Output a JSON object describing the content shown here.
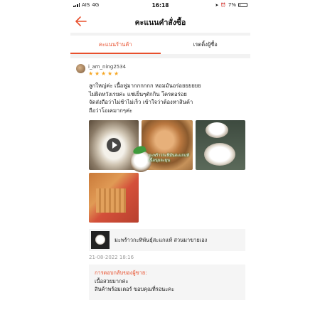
{
  "status_bar": {
    "carrier": "AIS",
    "network": "4G",
    "time": "16:18",
    "battery": "7%"
  },
  "header": {
    "title": "คะแนนคำสั่งซื้อ"
  },
  "tabs": [
    {
      "label": "คะแนนร้านค้า",
      "active": true
    },
    {
      "label": "เรตติ้งผู้ซื้อ",
      "active": false
    }
  ],
  "review": {
    "username": "i_am_ning2534",
    "rating": 5,
    "lines": [
      "ลูกใหญ่ค่ะ เนื้อฟูมากกกกกก หอมมันอร่อยยยยยย",
      "ไม่ผิดหวังเรยค่ะ แช่เย็นๆตักกิน โครตอร่อย",
      "จัดส่งถือว่าไม่ช้าไม่เร็ว เข้าใจว่าต้องหาสินค้า",
      "ถือว่าโอเคมากๆค่ะ"
    ],
    "promo_overlay": [
      "มะพร้าวกะทิมันสะแกแท้",
      "เนื้อนุ่มละมุน"
    ],
    "product_name": "มะพร้าวกะทิพันธุ์สะแกแท้ สวนมาขายเอง",
    "date": "21-08-2022 18:16"
  },
  "seller_reply": {
    "title": "การตอบกลับของผู้ขาย:",
    "lines": [
      "เนื้อสวยมากค่ะ",
      "สินค้าพร้อมเตอร์ ขอบคุณที่รอนะคะ"
    ]
  },
  "colors": {
    "accent": "#e8502d",
    "star": "#f5a623",
    "date_text": "#9a9a9a"
  },
  "icons": {
    "back": "arrow-left-icon",
    "play": "play-icon",
    "star": "star-icon"
  }
}
